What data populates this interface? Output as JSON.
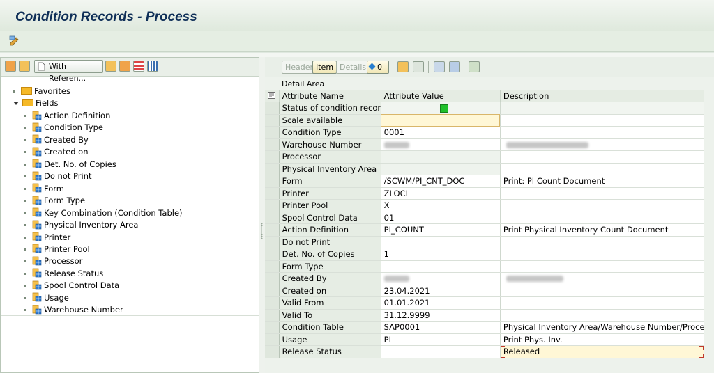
{
  "window": {
    "title": "Condition Records - Process"
  },
  "left": {
    "toolbar": {
      "with_reference_label": "With Referen..."
    },
    "tree": [
      {
        "label": "Favorites",
        "type": "folder",
        "expanded": false
      },
      {
        "label": "Fields",
        "type": "folder",
        "expanded": true
      }
    ],
    "fields": [
      "Action Definition",
      "Condition Type",
      "Created By",
      "Created on",
      "Det. No. of Copies",
      "Do not Print",
      "Form",
      "Form Type",
      "Key Combination (Condition Table)",
      "Physical Inventory Area",
      "Printer",
      "Printer Pool",
      "Processor",
      "Release Status",
      "Spool Control Data",
      "Usage",
      "Warehouse Number"
    ]
  },
  "right": {
    "toolbar": {
      "header": "Header",
      "item": "Item",
      "details": "Details",
      "counter": "0"
    },
    "area_title": "Detail Area",
    "columns": [
      "Attribute Name",
      "Attribute Value",
      "Description"
    ],
    "rows": [
      {
        "name": "Status of condition record",
        "value": "",
        "desc": "",
        "status": "green"
      },
      {
        "name": "Scale available",
        "value": "",
        "desc": "",
        "input": true
      },
      {
        "name": "Condition Type",
        "value": "0001",
        "desc": ""
      },
      {
        "name": "Warehouse Number",
        "value": "",
        "desc": "",
        "redacted_value": true,
        "redacted_desc": true
      },
      {
        "name": "Processor",
        "value": "",
        "desc": ""
      },
      {
        "name": "Physical Inventory Area",
        "value": "",
        "desc": ""
      },
      {
        "name": "Form",
        "value": "/SCWM/PI_CNT_DOC",
        "desc": "Print: PI Count Document"
      },
      {
        "name": "Printer",
        "value": "ZLOCL",
        "desc": ""
      },
      {
        "name": "Printer Pool",
        "value": "X",
        "desc": ""
      },
      {
        "name": "Spool Control Data",
        "value": "01",
        "desc": ""
      },
      {
        "name": "Action Definition",
        "value": "PI_COUNT",
        "desc": "Print Physical Inventory Count Document"
      },
      {
        "name": "Do not Print",
        "value": "",
        "desc": ""
      },
      {
        "name": "Det. No. of Copies",
        "value": "1",
        "desc": ""
      },
      {
        "name": "Form Type",
        "value": "",
        "desc": ""
      },
      {
        "name": "Created By",
        "value": "",
        "desc": "",
        "redacted_value": true,
        "redacted_desc": true
      },
      {
        "name": "Created on",
        "value": "23.04.2021",
        "desc": ""
      },
      {
        "name": "Valid From",
        "value": "01.01.2021",
        "desc": ""
      },
      {
        "name": "Valid To",
        "value": "31.12.9999",
        "desc": ""
      },
      {
        "name": "Condition Table",
        "value": "SAP0001",
        "desc": "Physical Inventory Area/Warehouse Number/Process..."
      },
      {
        "name": "Usage",
        "value": "PI",
        "desc": "Print Phys. Inv."
      },
      {
        "name": "Release Status",
        "value": "",
        "desc": "Released",
        "desc_highlight": true
      }
    ]
  },
  "colors": {
    "status_green": "#1fc02a",
    "title_text": "#0f2f58",
    "folder": "#f5b928"
  }
}
